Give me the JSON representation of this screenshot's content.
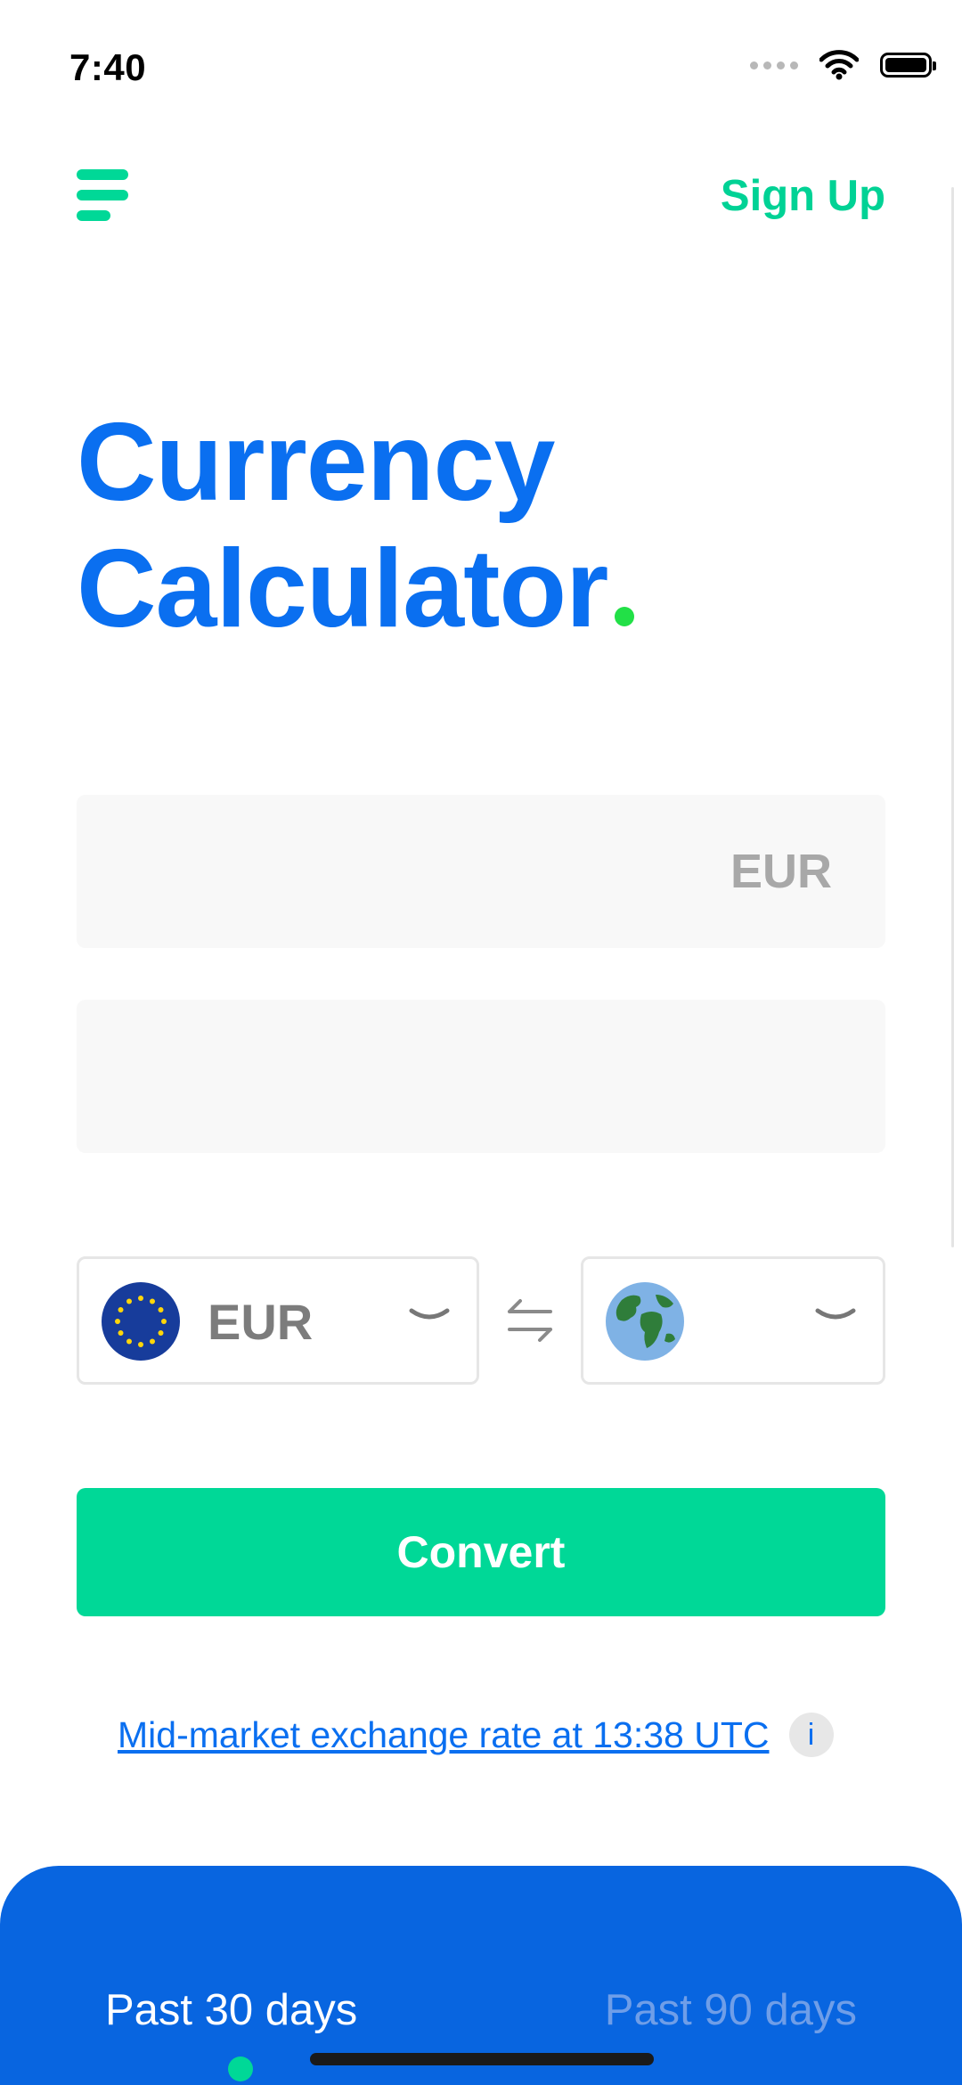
{
  "status_bar": {
    "time": "7:40"
  },
  "header": {
    "signup_label": "Sign Up"
  },
  "title": {
    "line1": "Currency",
    "line2": "Calculator"
  },
  "amount_field": {
    "suffix": "EUR",
    "value": ""
  },
  "result_field": {
    "value": ""
  },
  "from_currency": {
    "code": "EUR",
    "icon": "eu-flag-icon"
  },
  "to_currency": {
    "code": "",
    "icon": "globe-icon"
  },
  "convert_label": "Convert",
  "rate_note": {
    "text": "Mid-market exchange rate at 13:38 UTC",
    "info": "i"
  },
  "history_tabs": [
    {
      "label": "Past 30 days",
      "active": true
    },
    {
      "label": "Past 90 days",
      "active": false
    }
  ],
  "colors": {
    "accent_green": "#00d897",
    "brand_blue": "#0a6ff0",
    "panel_blue": "#0865e0"
  }
}
